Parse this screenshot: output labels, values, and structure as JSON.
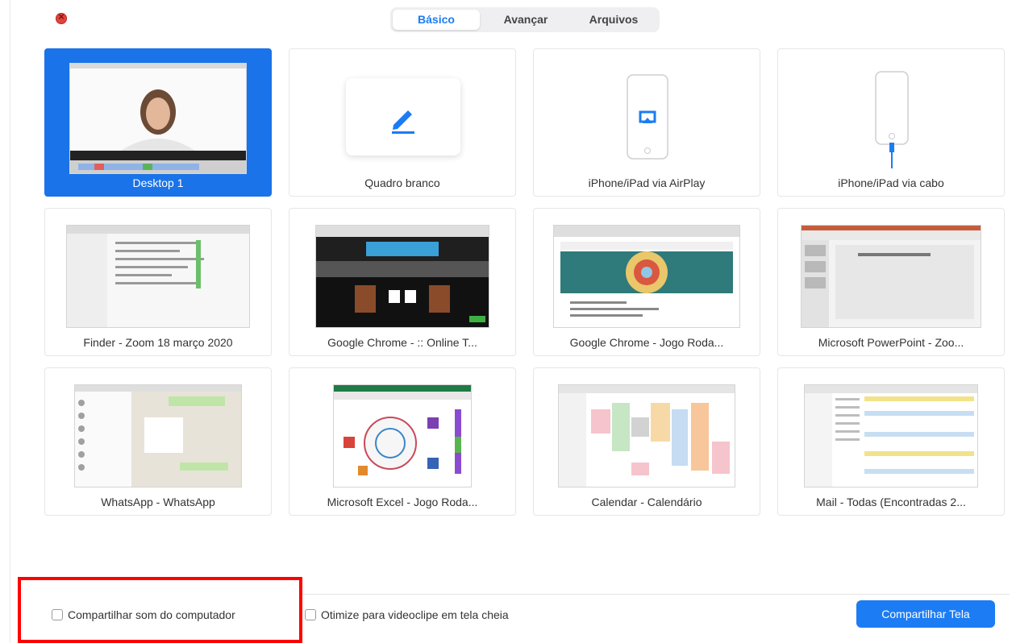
{
  "tabs": [
    {
      "label": "Básico",
      "active": true
    },
    {
      "label": "Avançar",
      "active": false
    },
    {
      "label": "Arquivos",
      "active": false
    }
  ],
  "tiles": [
    {
      "label": "Desktop 1",
      "selected": true
    },
    {
      "label": "Quadro branco",
      "icon": "pencil-icon"
    },
    {
      "label": "iPhone/iPad via AirPlay",
      "icon": "airplay-icon"
    },
    {
      "label": "iPhone/iPad via cabo",
      "icon": "cable-icon"
    },
    {
      "label": "Finder - Zoom 18 março 2020"
    },
    {
      "label": "Google Chrome - :: Online T..."
    },
    {
      "label": "Google Chrome - Jogo Roda..."
    },
    {
      "label": "Microsoft PowerPoint - Zoo..."
    },
    {
      "label": "WhatsApp - WhatsApp"
    },
    {
      "label": "Microsoft Excel - Jogo Roda..."
    },
    {
      "label": "Calendar - Calendário"
    },
    {
      "label": "Mail - Todas (Encontradas 2..."
    }
  ],
  "footer": {
    "share_sound_label": "Compartilhar som do computador",
    "optimize_label": "Otimize para videoclipe em tela cheia",
    "share_button": "Compartilhar Tela"
  },
  "colors": {
    "accent": "#1c7cf3",
    "selected_tile": "#1a73e8",
    "highlight_box": "#ff0000",
    "close": "#e0443e"
  }
}
